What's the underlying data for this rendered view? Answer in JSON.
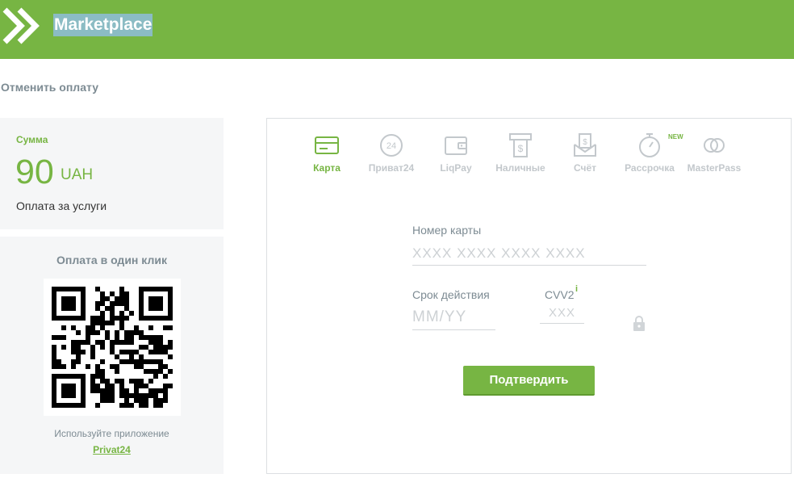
{
  "header": {
    "title": "Marketplace",
    "accent_color": "#77b543"
  },
  "cancel_link": "Отменить оплату",
  "amount": {
    "label": "Сумма",
    "value": "90",
    "currency": "UAH",
    "description": "Оплата за услуги"
  },
  "qr": {
    "title": "Оплата в один клик",
    "hint": "Используйте приложение",
    "app_link": "Privat24"
  },
  "methods": [
    {
      "label": "Карта",
      "icon": "card-icon",
      "active": true
    },
    {
      "label": "Приват24",
      "icon": "privat24-icon"
    },
    {
      "label": "LiqPay",
      "icon": "wallet-icon"
    },
    {
      "label": "Наличные",
      "icon": "cash-terminal-icon"
    },
    {
      "label": "Счёт",
      "icon": "invoice-icon"
    },
    {
      "label": "Рассрочка",
      "icon": "stopwatch-icon",
      "badge": "NEW"
    },
    {
      "label": "MasterPass",
      "icon": "masterpass-icon"
    }
  ],
  "form": {
    "card_number_label": "Номер карты",
    "card_number_placeholder": "XXXX XXXX XXXX XXXX",
    "expiry_label": "Срок действия",
    "expiry_placeholder": "MM/YY",
    "cvv_label": "CVV2",
    "cvv_info": "i",
    "cvv_placeholder": "XXX",
    "submit_label": "Подтвердить"
  }
}
